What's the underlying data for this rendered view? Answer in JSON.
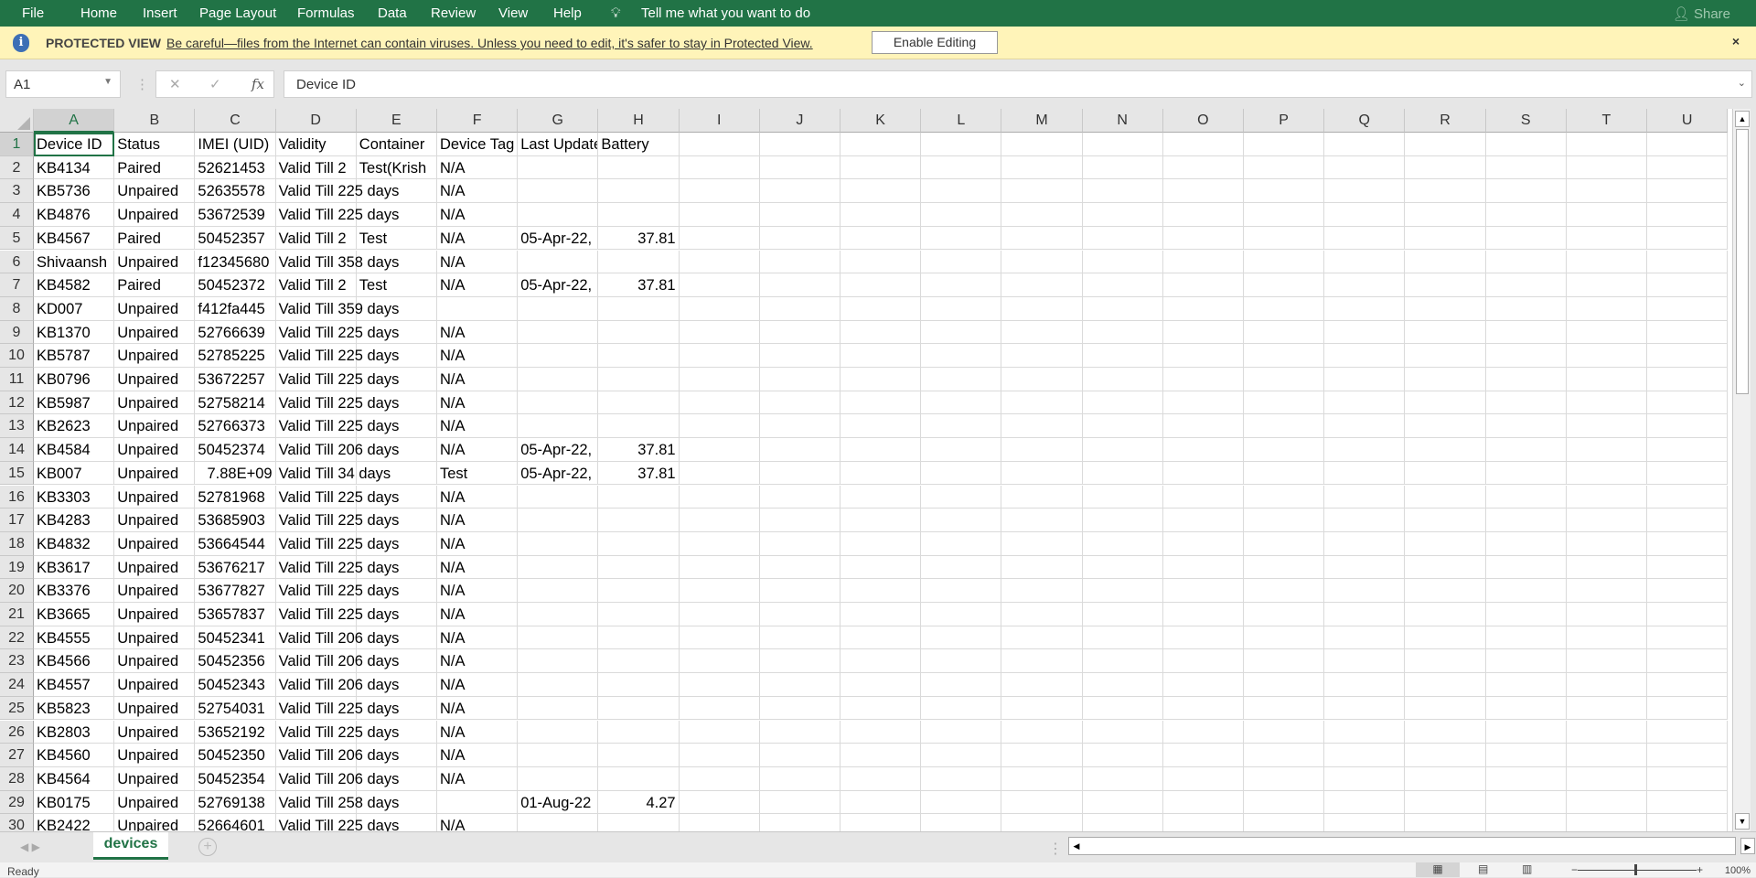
{
  "ribbon": {
    "tabs": [
      "File",
      "Home",
      "Insert",
      "Page Layout",
      "Formulas",
      "Data",
      "Review",
      "View",
      "Help"
    ],
    "tell_me": "Tell me what you want to do",
    "share": "Share",
    "color": "#217346"
  },
  "protected_view": {
    "title": "PROTECTED VIEW",
    "message": "Be careful—files from the Internet can contain viruses. Unless you need to edit, it's safer to stay in Protected View.",
    "button": "Enable Editing",
    "close": "×"
  },
  "formula_bar": {
    "name_box": "A1",
    "cancel": "✕",
    "enter": "✓",
    "fx": "fx",
    "content": "Device ID"
  },
  "grid": {
    "columns": [
      "A",
      "B",
      "C",
      "D",
      "E",
      "F",
      "G",
      "H",
      "I",
      "J",
      "K",
      "L",
      "M",
      "N",
      "O",
      "P",
      "Q",
      "R",
      "S",
      "T",
      "U"
    ],
    "rows": [
      [
        "Device ID",
        "Status",
        "IMEI (UID)",
        "Validity",
        "Container",
        "Device Tag",
        "Last Update",
        "Battery"
      ],
      [
        "KB4134",
        "Paired",
        "52621453",
        "Valid Till 2",
        "Test(Krish",
        "N/A",
        "",
        ""
      ],
      [
        "KB5736",
        "Unpaired",
        "52635578",
        "Valid Till 225 days",
        "",
        "N/A",
        "",
        ""
      ],
      [
        "KB4876",
        "Unpaired",
        "53672539",
        "Valid Till 225 days",
        "",
        "N/A",
        "",
        ""
      ],
      [
        "KB4567",
        "Paired",
        "50452357",
        "Valid Till 2",
        "Test",
        "N/A",
        "05-Apr-22,",
        "37.81"
      ],
      [
        "Shivaansh",
        "Unpaired",
        "f12345680",
        "Valid Till 358 days",
        "",
        "N/A",
        "",
        ""
      ],
      [
        "KB4582",
        "Paired",
        "50452372",
        "Valid Till 2",
        "Test",
        "N/A",
        "05-Apr-22,",
        "37.81"
      ],
      [
        "KD007",
        "Unpaired",
        "f412fa445",
        "Valid Till 359 days",
        "",
        "",
        "",
        ""
      ],
      [
        "KB1370",
        "Unpaired",
        "52766639",
        "Valid Till 225 days",
        "",
        "N/A",
        "",
        ""
      ],
      [
        "KB5787",
        "Unpaired",
        "52785225",
        "Valid Till 225 days",
        "",
        "N/A",
        "",
        ""
      ],
      [
        "KB0796",
        "Unpaired",
        "53672257",
        "Valid Till 225 days",
        "",
        "N/A",
        "",
        ""
      ],
      [
        "KB5987",
        "Unpaired",
        "52758214",
        "Valid Till 225 days",
        "",
        "N/A",
        "",
        ""
      ],
      [
        "KB2623",
        "Unpaired",
        "52766373",
        "Valid Till 225 days",
        "",
        "N/A",
        "",
        ""
      ],
      [
        "KB4584",
        "Unpaired",
        "50452374",
        "Valid Till 206 days",
        "",
        "N/A",
        "05-Apr-22,",
        "37.81"
      ],
      [
        "KB007",
        "Unpaired",
        "7.88E+09",
        "Valid Till 34 days",
        "",
        "Test",
        "05-Apr-22,",
        "37.81"
      ],
      [
        "KB3303",
        "Unpaired",
        "52781968",
        "Valid Till 225 days",
        "",
        "N/A",
        "",
        ""
      ],
      [
        "KB4283",
        "Unpaired",
        "53685903",
        "Valid Till 225 days",
        "",
        "N/A",
        "",
        ""
      ],
      [
        "KB4832",
        "Unpaired",
        "53664544",
        "Valid Till 225 days",
        "",
        "N/A",
        "",
        ""
      ],
      [
        "KB3617",
        "Unpaired",
        "53676217",
        "Valid Till 225 days",
        "",
        "N/A",
        "",
        ""
      ],
      [
        "KB3376",
        "Unpaired",
        "53677827",
        "Valid Till 225 days",
        "",
        "N/A",
        "",
        ""
      ],
      [
        "KB3665",
        "Unpaired",
        "53657837",
        "Valid Till 225 days",
        "",
        "N/A",
        "",
        ""
      ],
      [
        "KB4555",
        "Unpaired",
        "50452341",
        "Valid Till 206 days",
        "",
        "N/A",
        "",
        ""
      ],
      [
        "KB4566",
        "Unpaired",
        "50452356",
        "Valid Till 206 days",
        "",
        "N/A",
        "",
        ""
      ],
      [
        "KB4557",
        "Unpaired",
        "50452343",
        "Valid Till 206 days",
        "",
        "N/A",
        "",
        ""
      ],
      [
        "KB5823",
        "Unpaired",
        "52754031",
        "Valid Till 225 days",
        "",
        "N/A",
        "",
        ""
      ],
      [
        "KB2803",
        "Unpaired",
        "53652192",
        "Valid Till 225 days",
        "",
        "N/A",
        "",
        ""
      ],
      [
        "KB4560",
        "Unpaired",
        "50452350",
        "Valid Till 206 days",
        "",
        "N/A",
        "",
        ""
      ],
      [
        "KB4564",
        "Unpaired",
        "50452354",
        "Valid Till 206 days",
        "",
        "N/A",
        "",
        ""
      ],
      [
        "KB0175",
        "Unpaired",
        "52769138",
        "Valid Till 258 days",
        "",
        "",
        "01-Aug-22",
        "4.27"
      ],
      [
        "KB2422",
        "Unpaired",
        "52664601",
        "Valid Till 225 days",
        "",
        "N/A",
        "",
        ""
      ]
    ],
    "numeric_cells": [
      "7.88E+09",
      "37.81",
      "4.27"
    ]
  },
  "sheet_tabs": {
    "active": "devices",
    "add": "+"
  },
  "status": {
    "text": "Ready",
    "zoom": "100%"
  }
}
